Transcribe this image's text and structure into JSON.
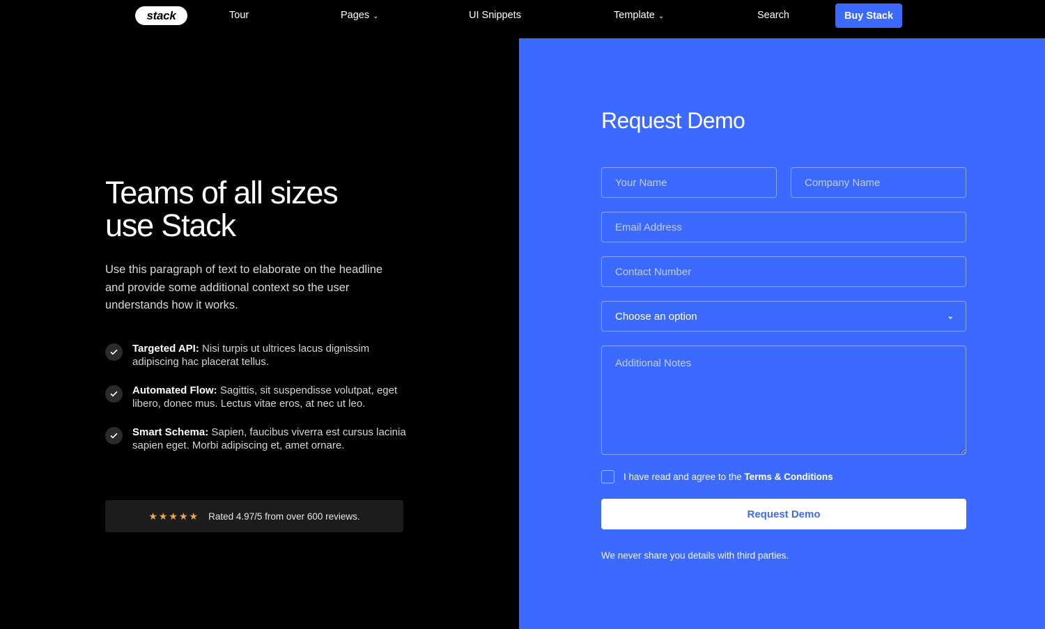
{
  "nav": {
    "logo": "stack",
    "items": [
      {
        "id": "tour",
        "label": "Tour",
        "has_caret": false
      },
      {
        "id": "pages",
        "label": "Pages",
        "has_caret": true
      },
      {
        "id": "snippets",
        "label": "UI Snippets",
        "has_caret": false
      },
      {
        "id": "template",
        "label": "Template",
        "has_caret": true
      },
      {
        "id": "search",
        "label": "Search",
        "has_caret": false
      }
    ],
    "caret_glyph": "⌄",
    "cta_label": "Buy Stack",
    "cta_color": "#3d6afe"
  },
  "hero": {
    "title": "Teams of all sizes\nuse Stack",
    "paragraph": "Use this paragraph of text to elaborate on the headline and provide some additional context so the user understands how it works.",
    "features": [
      {
        "title": "Targeted API:",
        "body": " Nisi turpis ut ultrices lacus dignissim adipiscing hac placerat tellus."
      },
      {
        "title": "Automated Flow:",
        "body": " Sagittis, sit suspendisse volutpat, eget libero, donec mus. Lectus vitae eros, at nec ut leo."
      },
      {
        "title": "Smart Schema:",
        "body": " Sapien, faucibus viverra est cursus lacinia sapien eget. Morbi adipiscing et, amet ornare."
      }
    ],
    "rating": {
      "stars": "★★★★★",
      "star_count": 5,
      "star_color": "#f0a84f",
      "text": "Rated 4.97/5 from over 600 reviews."
    }
  },
  "form": {
    "panel_color": "#3d6afe",
    "title": "Request Demo",
    "name_placeholder": "Your Name",
    "company_placeholder": "Company Name",
    "email_placeholder": "Email Address",
    "phone_placeholder": "Contact Number",
    "select_value": "Choose an option",
    "select_chevron": "⌄",
    "notes_placeholder": "Additional Notes",
    "terms_prefix": "I have read and agree to the ",
    "terms_link": "Terms & Conditions",
    "submit_label": "Request Demo",
    "privacy_note": "We never share you details with third parties."
  }
}
